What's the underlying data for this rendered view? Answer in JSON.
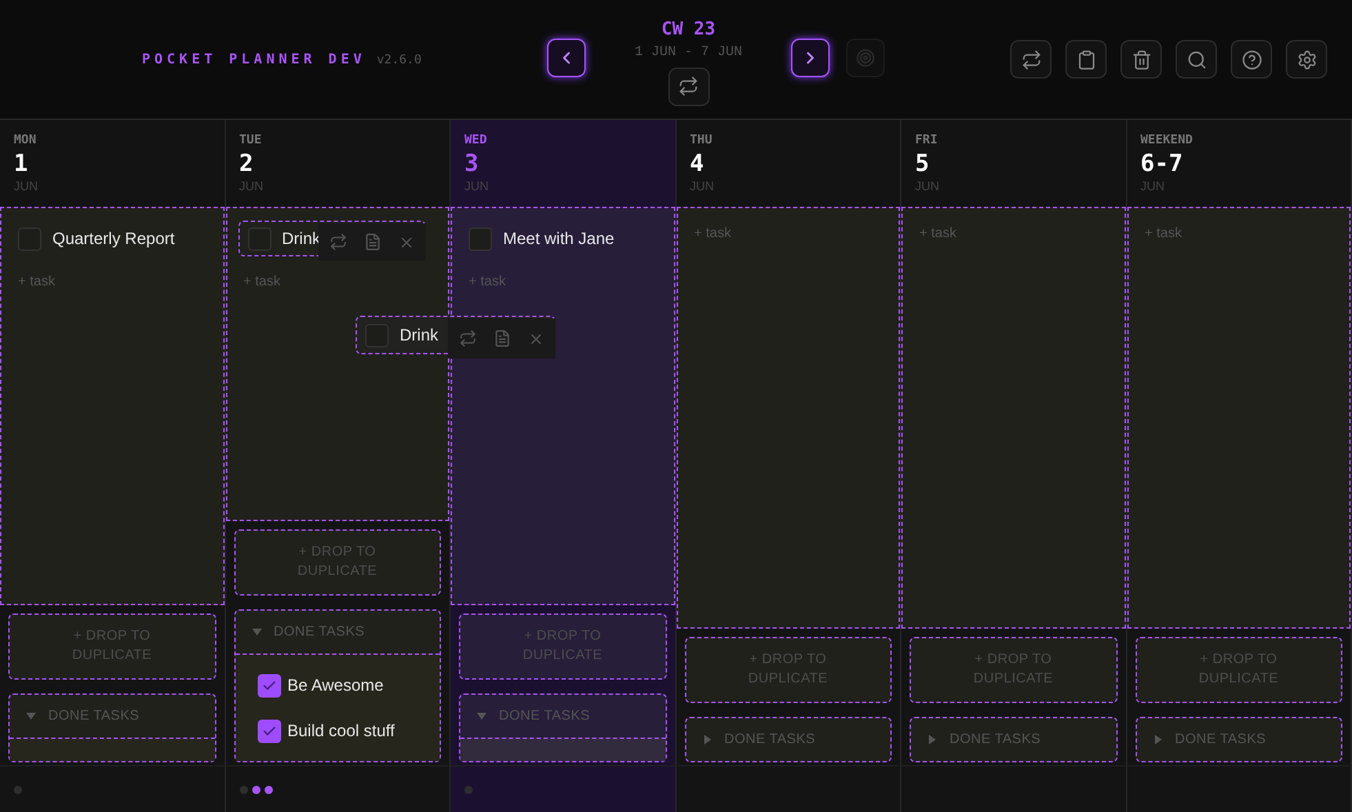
{
  "app": {
    "title": "POCKET PLANNER DEV",
    "version": "v2.6.0"
  },
  "week": {
    "label": "CW 23",
    "range": "1 JUN - 7 JUN"
  },
  "days": [
    {
      "weekday": "MON",
      "date": "1",
      "month": "JUN",
      "selected": false,
      "tasks": [
        {
          "text": "Quarterly Report",
          "checked": false,
          "show_actions": false
        }
      ],
      "add_label": "+ task",
      "drop_label": "+ DROP TO DUPLICATE",
      "done": {
        "label": "DONE TASKS",
        "expanded": true
      },
      "dots": [
        {
          "color": "#2e2e2e"
        }
      ]
    },
    {
      "weekday": "TUE",
      "date": "2",
      "month": "JUN",
      "selected": false,
      "tasks": [
        {
          "text": "Drink",
          "checked": false,
          "show_actions": true
        }
      ],
      "add_label": "+ task",
      "drop_label": "+ DROP TO DUPLICATE",
      "done": {
        "label": "DONE TASKS",
        "expanded": true,
        "tasks": [
          {
            "text": "Be Awesome",
            "checked": true
          },
          {
            "text": "Build cool stuff",
            "checked": true
          }
        ]
      },
      "dots": [
        {
          "color": "#2e2e2e"
        },
        {
          "color": "#a855f7"
        },
        {
          "color": "#a855f7"
        }
      ]
    },
    {
      "weekday": "WED",
      "date": "3",
      "month": "JUN",
      "selected": true,
      "tasks": [
        {
          "text": "Meet with Jane",
          "checked": false,
          "show_actions": false
        }
      ],
      "add_label": "+ task",
      "drop_label": "+ DROP TO DUPLICATE",
      "done": {
        "label": "DONE TASKS",
        "expanded": true
      },
      "dots": [
        {
          "color": "#2e2e2e"
        }
      ]
    },
    {
      "weekday": "THU",
      "date": "4",
      "month": "JUN",
      "selected": false,
      "add_label": "+ task",
      "drop_label": "+ DROP TO DUPLICATE",
      "done": {
        "label": "DONE TASKS",
        "expanded": false
      }
    },
    {
      "weekday": "FRI",
      "date": "5",
      "month": "JUN",
      "selected": false,
      "add_label": "+ task",
      "drop_label": "+ DROP TO DUPLICATE",
      "done": {
        "label": "DONE TASKS",
        "expanded": false
      }
    },
    {
      "weekday": "WEEKEND",
      "date": "6-7",
      "month": "JUN",
      "selected": false,
      "add_label": "+ task",
      "drop_label": "+ DROP TO DUPLICATE",
      "done": {
        "label": "DONE TASKS",
        "expanded": false
      }
    }
  ],
  "drag_ghost": {
    "text": "Drink",
    "checked": false
  }
}
